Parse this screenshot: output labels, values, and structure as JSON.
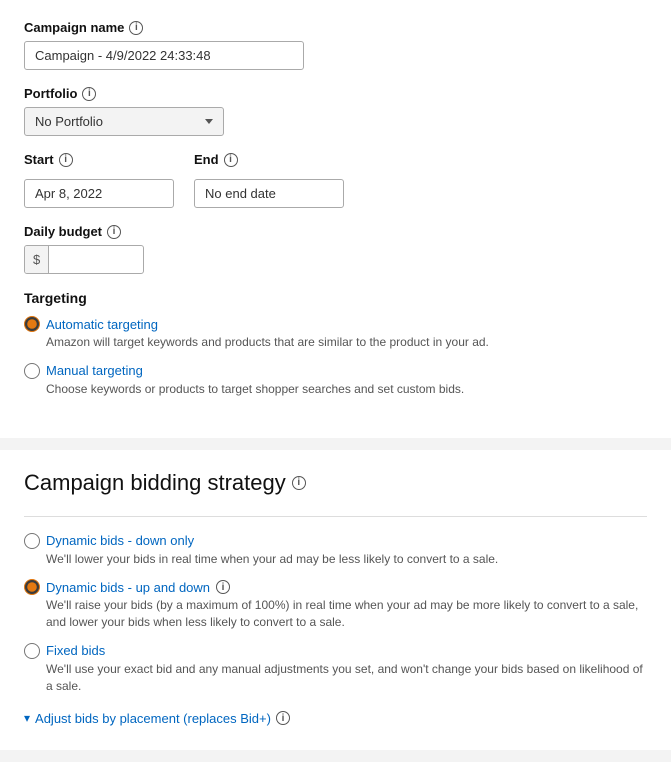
{
  "campaignSection": {
    "campaignName": {
      "label": "Campaign name",
      "value": "Campaign - 4/9/2022 24:33:48",
      "placeholder": ""
    },
    "portfolio": {
      "label": "Portfolio",
      "value": "No Portfolio",
      "options": [
        "No Portfolio"
      ]
    },
    "start": {
      "label": "Start",
      "value": "Apr 8, 2022"
    },
    "end": {
      "label": "End",
      "value": "No end date",
      "placeholder": "No end date"
    },
    "dailyBudget": {
      "label": "Daily budget",
      "prefix": "$",
      "value": ""
    },
    "targeting": {
      "label": "Targeting",
      "options": [
        {
          "id": "automatic",
          "label": "Automatic targeting",
          "description": "Amazon will target keywords and products that are similar to the product in your ad.",
          "checked": true
        },
        {
          "id": "manual",
          "label": "Manual targeting",
          "description": "Choose keywords or products to target shopper searches and set custom bids.",
          "checked": false
        }
      ]
    }
  },
  "biddingSection": {
    "title": "Campaign bidding strategy",
    "options": [
      {
        "id": "down-only",
        "label": "Dynamic bids - down only",
        "description": "We'll lower your bids in real time when your ad may be less likely to convert to a sale.",
        "checked": false,
        "hasInfo": false
      },
      {
        "id": "up-down",
        "label": "Dynamic bids - up and down",
        "description": "We'll raise your bids (by a maximum of 100%) in real time when your ad may be more likely to convert to a sale, and lower your bids when less likely to convert to a sale.",
        "checked": true,
        "hasInfo": true
      },
      {
        "id": "fixed",
        "label": "Fixed bids",
        "description": "We'll use your exact bid and any manual adjustments you set, and won't change your bids based on likelihood of a sale.",
        "checked": false,
        "hasInfo": false
      }
    ],
    "adjustBids": {
      "label": "Adjust bids by placement (replaces Bid+)"
    }
  },
  "icons": {
    "info": "i",
    "chevron_down": "▾"
  }
}
